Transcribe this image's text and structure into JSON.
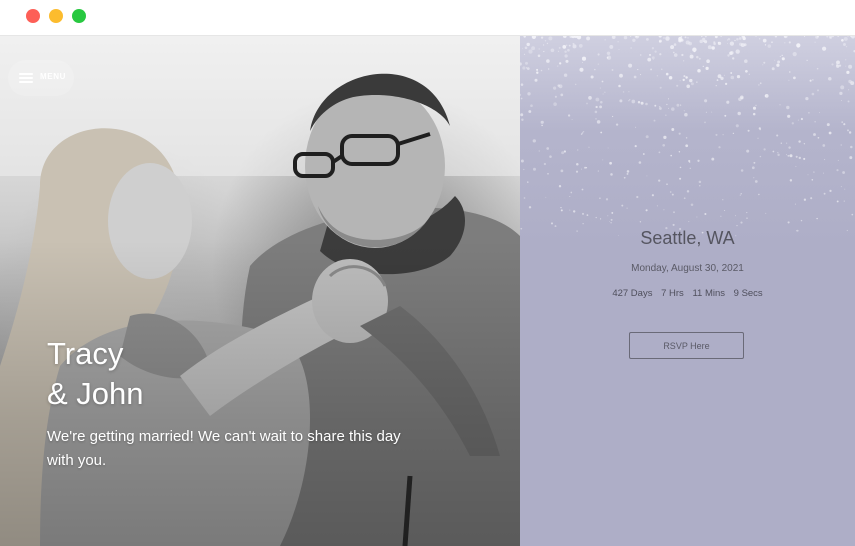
{
  "window": {
    "controls": [
      "close",
      "minimize",
      "maximize"
    ],
    "colors": {
      "close": "#fd5f57",
      "minimize": "#fcbc2e",
      "maximize": "#28c840"
    }
  },
  "nav": {
    "menu_label": "MENU",
    "menu_icon": "hamburger-icon"
  },
  "hero": {
    "name_line1": "Tracy",
    "name_line2": "& John",
    "tagline": "We're getting married! We can't wait to share this day with you.",
    "photo": "black-and-white photo of couple dancing"
  },
  "event": {
    "location": "Seattle, WA",
    "date": "Monday, August 30, 2021",
    "countdown": {
      "days": "427 Days",
      "hours": "7 Hrs",
      "mins": "11 Mins",
      "secs": "9 Secs"
    },
    "rsvp_label": "RSVP Here",
    "panel_color": "#aeaec7"
  }
}
